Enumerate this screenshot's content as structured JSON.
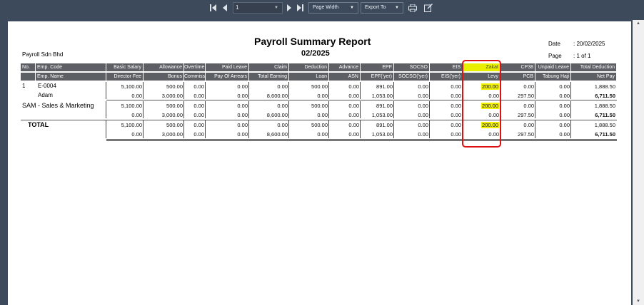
{
  "toolbar": {
    "page_value": "1",
    "zoom_label": "Page Width",
    "export_label": "Export To"
  },
  "report": {
    "title": "Payroll Summary Report",
    "period": "02/2025",
    "company": "Payroll Sdn Bhd",
    "date_label": "Date",
    "date_value": ": 20/02/2025",
    "page_label": "Page",
    "page_value": ":  1 of 1"
  },
  "headers_row1": [
    "No.",
    "Emp. Code",
    "Basic Salary",
    "Allowance",
    "Overtime",
    "Paid Leave",
    "Claim",
    "Deduction",
    "Advance",
    "EPF",
    "SOCSO",
    "EIS",
    "Zakat",
    "CP38",
    "Unpaid Leave",
    "Total Deduction"
  ],
  "headers_row2": [
    "",
    "Emp. Name",
    "Director Fee",
    "Bonus",
    "Commission",
    "Pay Of Arrears",
    "Total Earning",
    "Loan",
    "ASN",
    "EPF('yer)",
    "SOCSO('yer)",
    "EIS('yer)",
    "Levy",
    "PCB",
    "Tabung Haji",
    "Net Pay"
  ],
  "employee": {
    "no": "1",
    "code": "E-0004",
    "name": "Adam",
    "row1": [
      "5,100.00",
      "500.00",
      "0.00",
      "0.00",
      "0.00",
      "500.00",
      "0.00",
      "891.00",
      "0.00",
      "0.00",
      "200.00",
      "0.00",
      "0.00",
      "1,888.50"
    ],
    "row2": [
      "0.00",
      "3,000.00",
      "0.00",
      "0.00",
      "8,600.00",
      "0.00",
      "0.00",
      "1,053.00",
      "0.00",
      "0.00",
      "0.00",
      "297.50",
      "0.00",
      "6,711.50"
    ]
  },
  "department": {
    "label": "SAM - Sales & Marketing",
    "row1": [
      "5,100.00",
      "500.00",
      "0.00",
      "0.00",
      "0.00",
      "500.00",
      "0.00",
      "891.00",
      "0.00",
      "0.00",
      "200.00",
      "0.00",
      "0.00",
      "1,888.50"
    ],
    "row2": [
      "0.00",
      "3,000.00",
      "0.00",
      "0.00",
      "8,600.00",
      "0.00",
      "0.00",
      "1,053.00",
      "0.00",
      "0.00",
      "0.00",
      "297.50",
      "0.00",
      "6,711.50"
    ]
  },
  "total": {
    "label": "TOTAL",
    "row1": [
      "5,100.00",
      "500.00",
      "0.00",
      "0.00",
      "0.00",
      "500.00",
      "0.00",
      "891.00",
      "0.00",
      "0.00",
      "200.00",
      "0.00",
      "0.00",
      "1,888.50"
    ],
    "row2": [
      "0.00",
      "3,000.00",
      "0.00",
      "0.00",
      "8,600.00",
      "0.00",
      "0.00",
      "1,053.00",
      "0.00",
      "0.00",
      "0.00",
      "297.50",
      "0.00",
      "6,711.50"
    ]
  },
  "highlight_color": "#f2f200",
  "annotation_color": "#e01010"
}
